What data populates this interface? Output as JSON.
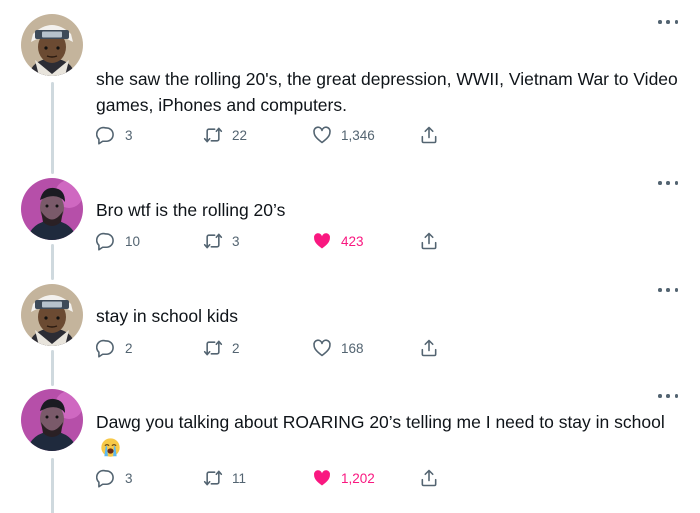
{
  "tweets": [
    {
      "avatar": "naruto-headband-avatar",
      "text": "she saw the rolling 20's, the great depression, WWII, Vietnam War to Video games, iPhones and computers.",
      "replies": "3",
      "retweets": "22",
      "likes": "1,346",
      "liked": false
    },
    {
      "avatar": "bearded-man-avatar",
      "text": "Bro wtf is the rolling 20’s",
      "replies": "10",
      "retweets": "3",
      "likes": "423",
      "liked": true
    },
    {
      "avatar": "naruto-headband-avatar",
      "text": "stay in school kids",
      "replies": "2",
      "retweets": "2",
      "likes": "168",
      "liked": false
    },
    {
      "avatar": "bearded-man-avatar",
      "text": "Dawg you talking about ROARING 20’s telling me I need to stay in school",
      "text_emoji": "loudly-crying-face",
      "replies": "3",
      "retweets": "11",
      "likes": "1,202",
      "liked": true
    }
  ],
  "colors": {
    "text": "#0f1419",
    "muted": "#536471",
    "like": "#f91880",
    "thread": "#cfd9de"
  }
}
